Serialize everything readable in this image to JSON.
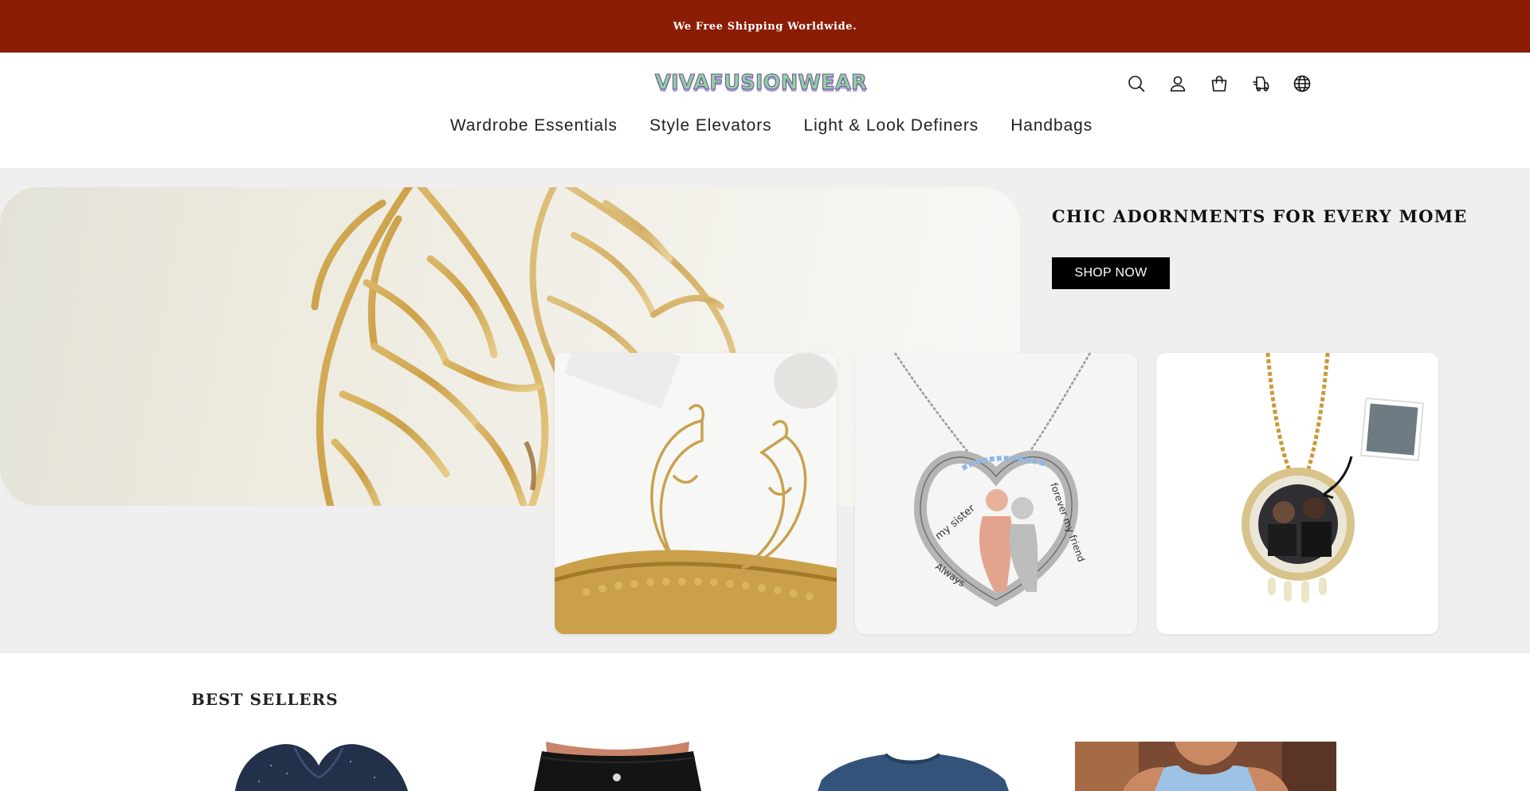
{
  "announcement": {
    "text": "We Free Shipping Worldwide."
  },
  "header": {
    "logo_text": "VIVAFUSIONWEAR",
    "icons": [
      "search-icon",
      "account-icon",
      "cart-icon",
      "tracking-icon",
      "globe-icon"
    ]
  },
  "nav": {
    "items": [
      {
        "label": "Wardrobe Essentials"
      },
      {
        "label": "Style Elevators"
      },
      {
        "label": "Light & Look Definers"
      },
      {
        "label": "Handbags"
      }
    ]
  },
  "hero": {
    "title": "CHIC ADORNMENTS FOR EVERY MOME",
    "cta_label": "SHOP NOW",
    "cards": [
      {
        "image": "gold-face-earrings"
      },
      {
        "image": "sister-heart-necklace",
        "engraving": [
          "my sister",
          "forever my friend",
          "Always"
        ]
      },
      {
        "image": "photo-pendant-necklace"
      }
    ]
  },
  "best_sellers": {
    "title": "BEST SELLERS",
    "products": [
      {
        "image": "navy-hoodie"
      },
      {
        "image": "black-jeans"
      },
      {
        "image": "blue-tshirt"
      },
      {
        "image": "blue-tank-top-man"
      }
    ]
  },
  "colors": {
    "announcement_bg": "#8b1c06",
    "hero_bg": "#efefef",
    "button_bg": "#000000"
  }
}
